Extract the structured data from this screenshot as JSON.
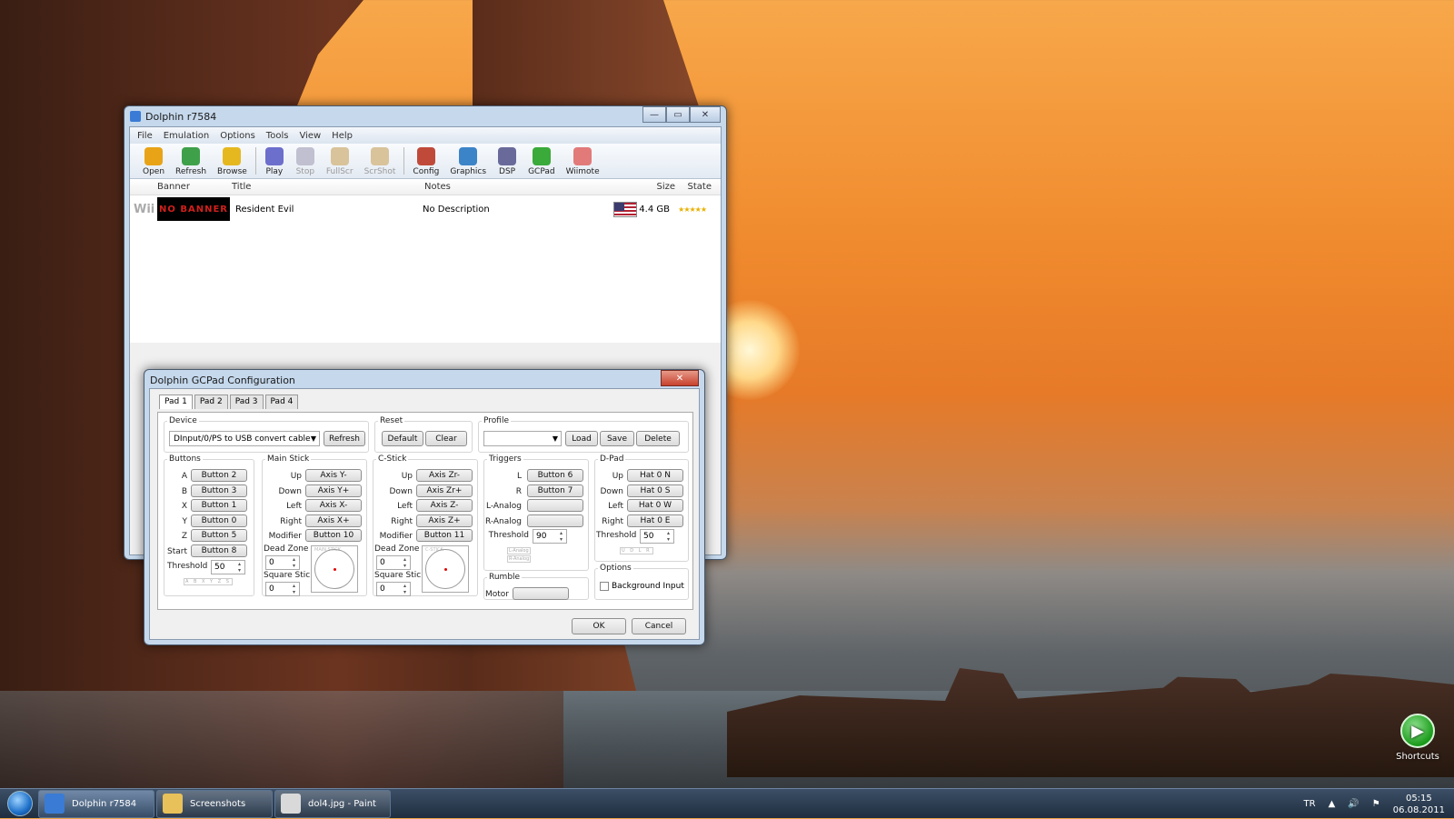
{
  "main_window": {
    "title": "Dolphin r7584",
    "menu": [
      "File",
      "Emulation",
      "Options",
      "Tools",
      "View",
      "Help"
    ],
    "toolbar": [
      {
        "label": "Open",
        "icon": "folder-icon",
        "color": "#e8a317",
        "enabled": true
      },
      {
        "label": "Refresh",
        "icon": "refresh-icon",
        "color": "#3fa04a",
        "enabled": true
      },
      {
        "label": "Browse",
        "icon": "star-icon",
        "color": "#e6b820",
        "enabled": true
      },
      {
        "label": "Play",
        "icon": "play-icon",
        "color": "#6d6fcc",
        "enabled": true
      },
      {
        "label": "Stop",
        "icon": "stop-icon",
        "color": "#c0c0d0",
        "enabled": false
      },
      {
        "label": "FullScr",
        "icon": "fullscreen-icon",
        "color": "#d9c39a",
        "enabled": false
      },
      {
        "label": "ScrShot",
        "icon": "screenshot-icon",
        "color": "#d9c39a",
        "enabled": false
      },
      {
        "label": "Config",
        "icon": "wrench-icon",
        "color": "#c04a3a",
        "enabled": true
      },
      {
        "label": "Graphics",
        "icon": "monitor-icon",
        "color": "#3c84c8",
        "enabled": true
      },
      {
        "label": "DSP",
        "icon": "speaker-icon",
        "color": "#6a6a9a",
        "enabled": true
      },
      {
        "label": "GCPad",
        "icon": "gcpad-icon",
        "color": "#3aaa3a",
        "enabled": true
      },
      {
        "label": "Wiimote",
        "icon": "wiimote-icon",
        "color": "#e27a7a",
        "enabled": true
      }
    ],
    "columns": {
      "banner": "Banner",
      "title": "Title",
      "notes": "Notes",
      "size": "Size",
      "state": "State"
    },
    "games": [
      {
        "platform": "Wii",
        "banner": "NO BANNER",
        "title": "Resident Evil",
        "notes": "No Description",
        "size": "4.4 GB",
        "state": "★★★★★"
      }
    ]
  },
  "gcpad": {
    "title": "Dolphin GCPad Configuration",
    "tabs": [
      "Pad 1",
      "Pad 2",
      "Pad 3",
      "Pad 4"
    ],
    "device": {
      "legend": "Device",
      "value": "DInput/0/PS to USB convert cable",
      "refresh": "Refresh"
    },
    "reset": {
      "legend": "Reset",
      "default": "Default",
      "clear": "Clear"
    },
    "profile": {
      "legend": "Profile",
      "value": "",
      "load": "Load",
      "save": "Save",
      "delete": "Delete"
    },
    "buttons": {
      "legend": "Buttons",
      "rows": [
        {
          "label": "A",
          "value": "Button 2"
        },
        {
          "label": "B",
          "value": "Button 3"
        },
        {
          "label": "X",
          "value": "Button 1"
        },
        {
          "label": "Y",
          "value": "Button 0"
        },
        {
          "label": "Z",
          "value": "Button 5"
        },
        {
          "label": "Start",
          "value": "Button 8"
        }
      ],
      "threshold_label": "Threshold",
      "threshold": "50",
      "mini": "A B X Y Z S"
    },
    "main_stick": {
      "legend": "Main Stick",
      "rows": [
        {
          "label": "Up",
          "value": "Axis Y-"
        },
        {
          "label": "Down",
          "value": "Axis Y+"
        },
        {
          "label": "Left",
          "value": "Axis X-"
        },
        {
          "label": "Right",
          "value": "Axis X+"
        },
        {
          "label": "Modifier",
          "value": "Button 10"
        }
      ],
      "dead_zone_label": "Dead Zone",
      "dead_zone": "0",
      "square_label": "Square Stick",
      "square": "0",
      "box_label": "MAIN STICK"
    },
    "c_stick": {
      "legend": "C-Stick",
      "rows": [
        {
          "label": "Up",
          "value": "Axis Zr-"
        },
        {
          "label": "Down",
          "value": "Axis Zr+"
        },
        {
          "label": "Left",
          "value": "Axis Z-"
        },
        {
          "label": "Right",
          "value": "Axis Z+"
        },
        {
          "label": "Modifier",
          "value": "Button 11"
        }
      ],
      "dead_zone_label": "Dead Zone",
      "dead_zone": "0",
      "square_label": "Square Stick",
      "square": "0",
      "box_label": "C-STICK"
    },
    "triggers": {
      "legend": "Triggers",
      "rows": [
        {
          "label": "L",
          "value": "Button 6"
        },
        {
          "label": "R",
          "value": "Button 7"
        },
        {
          "label": "L-Analog",
          "value": ""
        },
        {
          "label": "R-Analog",
          "value": ""
        }
      ],
      "threshold_label": "Threshold",
      "threshold": "90",
      "mini1": "L-Analog",
      "mini2": "R-Analog"
    },
    "dpad": {
      "legend": "D-Pad",
      "rows": [
        {
          "label": "Up",
          "value": "Hat 0 N"
        },
        {
          "label": "Down",
          "value": "Hat 0 S"
        },
        {
          "label": "Left",
          "value": "Hat 0 W"
        },
        {
          "label": "Right",
          "value": "Hat 0 E"
        }
      ],
      "threshold_label": "Threshold",
      "threshold": "50",
      "mini": "U D L R"
    },
    "rumble": {
      "legend": "Rumble",
      "motor_label": "Motor",
      "motor": ""
    },
    "options": {
      "legend": "Options",
      "background_input": "Background Input"
    },
    "ok": "OK",
    "cancel": "Cancel"
  },
  "taskbar": {
    "items": [
      {
        "label": "Dolphin r7584",
        "active": true
      },
      {
        "label": "Screenshots",
        "active": false
      },
      {
        "label": "dol4.jpg - Paint",
        "active": false
      }
    ],
    "lang": "TR",
    "time": "05:15",
    "date": "06.08.2011"
  },
  "desktop": {
    "shortcut_label": "Shortcuts"
  }
}
